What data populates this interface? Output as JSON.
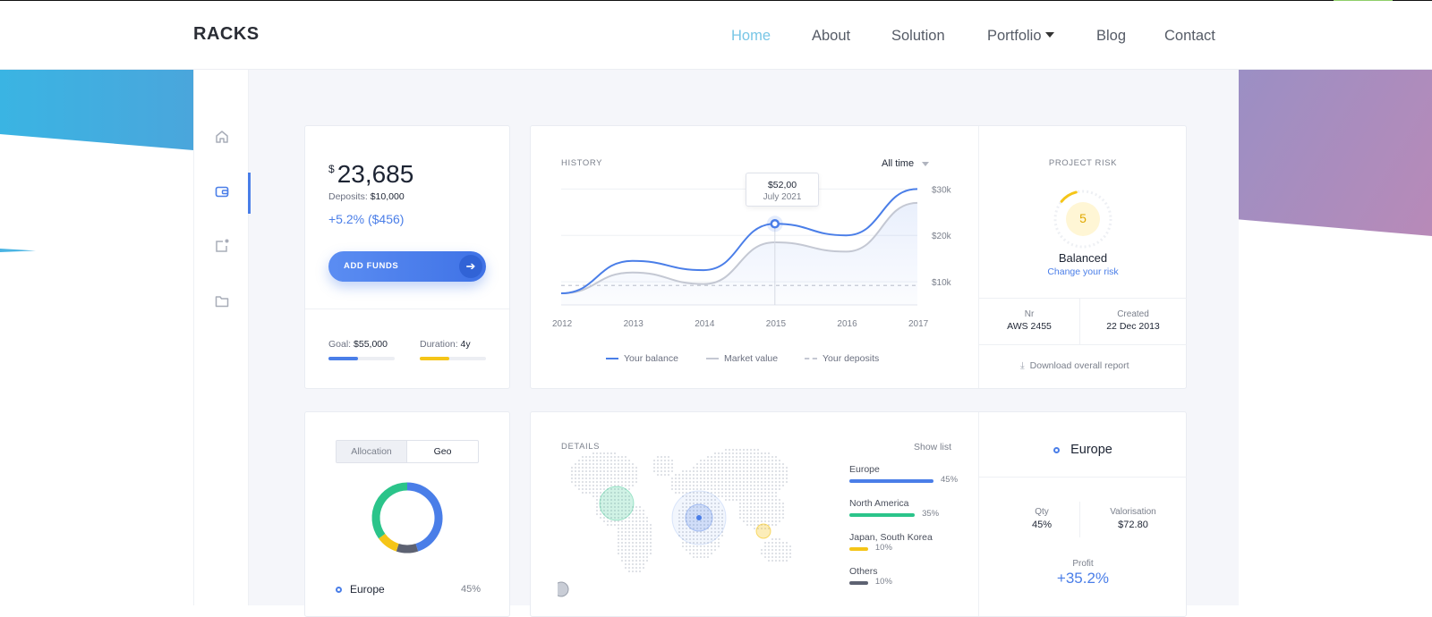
{
  "nav": {
    "logo": "RACKS",
    "items": [
      "Home",
      "About",
      "Solution",
      "Portfolio",
      "Blog",
      "Contact"
    ]
  },
  "sidebar": {
    "icons": [
      "home-icon",
      "wallet-icon",
      "add-note-icon",
      "folder-icon"
    ]
  },
  "balance": {
    "currency": "$",
    "amount": "23,685",
    "deposits_label": "Deposits:",
    "deposits_value": "$10,000",
    "change": "+5.2% ($456)",
    "add_funds": "ADD FUNDS",
    "goal_label": "Goal:",
    "goal_value": "$55,000",
    "goal_progress": 0.45,
    "duration_label": "Duration:",
    "duration_value": "4y",
    "duration_progress": 0.45
  },
  "history": {
    "title": "HISTORY",
    "range": "All time",
    "tooltip_value": "$52,00",
    "tooltip_date": "July 2021",
    "legend": [
      "Your balance",
      "Market value",
      "Your deposits"
    ]
  },
  "chart_data": {
    "type": "line",
    "title": "HISTORY",
    "x": [
      2012,
      2013,
      2014,
      2015,
      2016,
      2017
    ],
    "yticks": [
      "$10k",
      "$20k",
      "$30k"
    ],
    "ylim": [
      5,
      32
    ],
    "series": [
      {
        "name": "Your balance",
        "x": [
          2012,
          2013,
          2014,
          2015,
          2016,
          2017
        ],
        "values": [
          7.5,
          14.5,
          12.5,
          22.5,
          20,
          30
        ]
      },
      {
        "name": "Market value",
        "x": [
          2012,
          2013,
          2014,
          2015,
          2016,
          2017
        ],
        "values": [
          7.5,
          12,
          9.5,
          18.5,
          16.5,
          27
        ]
      },
      {
        "name": "Your deposits",
        "x": [
          2012,
          2013,
          2014,
          2015,
          2016,
          2017
        ],
        "values": [
          9.2,
          9.2,
          9.2,
          9.2,
          9.2,
          9.2
        ]
      }
    ],
    "colors": [
      "#4a7ee8",
      "#c4c8d3",
      "#c4c8d3"
    ]
  },
  "risk": {
    "title": "PROJECT RISK",
    "level": "5",
    "level_fraction": 0.1,
    "label": "Balanced",
    "link": "Change your risk",
    "nr_label": "Nr",
    "nr_value": "AWS 2455",
    "created_label": "Created",
    "created_value": "22 Dec 2013",
    "download": "Download overall report"
  },
  "allocation": {
    "tabs": [
      "Allocation",
      "Geo"
    ],
    "legend_item": "Europe",
    "legend_value": "45%",
    "donut": [
      {
        "name": "Europe",
        "value": 45,
        "color": "#4a7ee8"
      },
      {
        "name": "Others",
        "value": 10,
        "color": "#5d6272"
      },
      {
        "name": "Japan, South Korea",
        "value": 10,
        "color": "#f5c518"
      },
      {
        "name": "North America",
        "value": 35,
        "color": "#2bc48a"
      }
    ]
  },
  "details": {
    "title": "DETAILS",
    "show_list": "Show list",
    "regions": [
      {
        "name": "Europe",
        "pct": "45%",
        "value": 45,
        "color": "#4a7ee8"
      },
      {
        "name": "North America",
        "pct": "35%",
        "value": 35,
        "color": "#2bc48a"
      },
      {
        "name": "Japan, South Korea",
        "pct": "10%",
        "value": 10,
        "color": "#f5c518"
      },
      {
        "name": "Others",
        "pct": "10%",
        "value": 10,
        "color": "#5d6272"
      }
    ]
  },
  "region_detail": {
    "name": "Europe",
    "qty_label": "Qty",
    "qty_value": "45%",
    "val_label": "Valorisation",
    "val_value": "$72.80",
    "profit_label": "Profit",
    "profit_value": "+35.2%"
  },
  "colors": {
    "accent": "#4a7ee8",
    "nav_active": "#78c6e6",
    "yellow": "#f5c518",
    "green": "#2bc48a"
  }
}
